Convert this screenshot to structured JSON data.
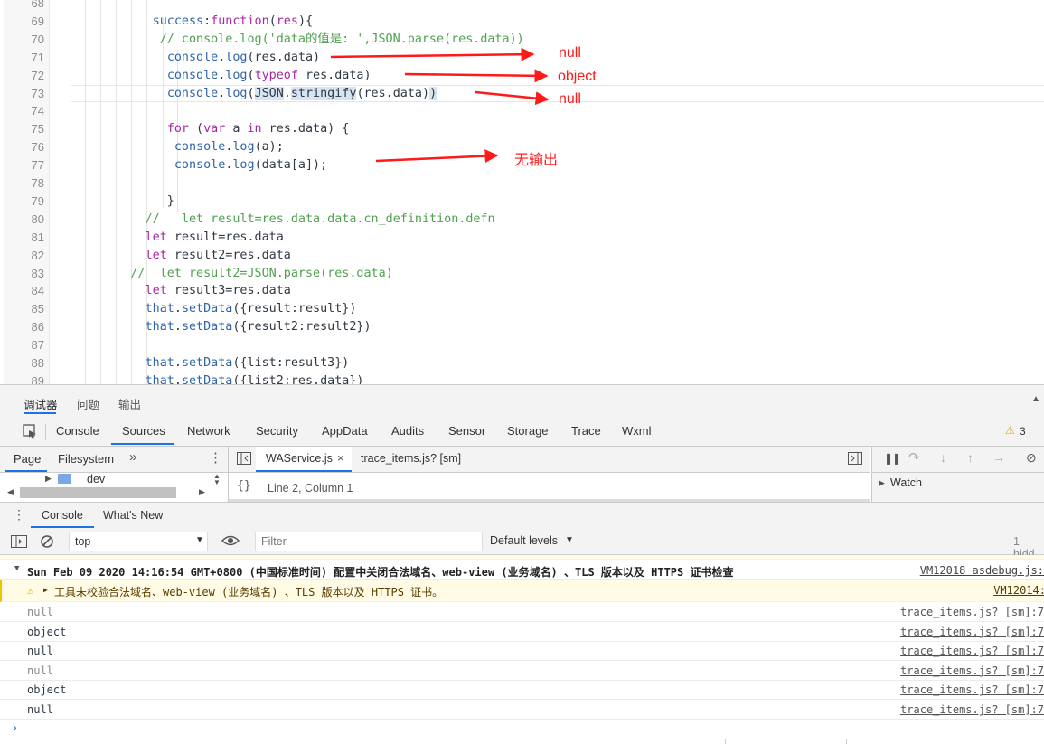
{
  "editor": {
    "lines": [
      {
        "num": "68",
        "html": ""
      },
      {
        "num": "69",
        "html": "           <span class='fn'>success</span>:<span class='kw'>function</span>(<span class='kw'>res</span>){"
      },
      {
        "num": "70",
        "html": "            <span class='cm'>// console.log('data的值是: ',JSON.parse(res.data))</span>"
      },
      {
        "num": "71",
        "html": "             <span class='fn'>console</span>.<span class='fn'>log</span>(res.data)"
      },
      {
        "num": "72",
        "html": "             <span class='fn'>console</span>.<span class='fn'>log</span>(<span class='ty'>typeof</span> res.data)"
      },
      {
        "num": "73",
        "html": "             <span class='fn'>console</span>.<span class='fn'>log</span>(<span class='hl'>JSON</span>.<span class='hl'>stringify</span>(res.data)<span class='hl'>)</span>"
      },
      {
        "num": "74",
        "html": ""
      },
      {
        "num": "75",
        "html": "             <span class='kw'>for</span> (<span class='kw'>var</span> a <span class='kw'>in</span> res.data) {"
      },
      {
        "num": "76",
        "html": "              <span class='fn'>console</span>.<span class='fn'>log</span>(a);"
      },
      {
        "num": "77",
        "html": "              <span class='fn'>console</span>.<span class='fn'>log</span>(data[a]);"
      },
      {
        "num": "78",
        "html": ""
      },
      {
        "num": "79",
        "html": "             }"
      },
      {
        "num": "80",
        "html": "          <span class='cm'>//   let result=res.data.data.cn_definition.defn</span>"
      },
      {
        "num": "81",
        "html": "          <span class='kw'>let</span> result=res.data"
      },
      {
        "num": "82",
        "html": "          <span class='kw'>let</span> result2=res.data"
      },
      {
        "num": "83",
        "html": "        <span class='cm'>//  let result2=JSON.parse(res.data)</span>"
      },
      {
        "num": "84",
        "html": "          <span class='kw'>let</span> result3=res.data"
      },
      {
        "num": "85",
        "html": "          <span class='fn'>that</span>.<span class='fn'>setData</span>({result:result})"
      },
      {
        "num": "86",
        "html": "          <span class='fn'>that</span>.<span class='fn'>setData</span>({result2:result2})"
      },
      {
        "num": "87",
        "html": ""
      },
      {
        "num": "88",
        "html": "          <span class='fn'>that</span>.<span class='fn'>setData</span>({list:result3})"
      },
      {
        "num": "89",
        "html": "          <span class='fn'>that</span>.<span class='fn'>setData</span>({list2:res.data})"
      }
    ],
    "annotations": {
      "a1": "null",
      "a2": "object",
      "a3": "null",
      "a4": "无输出"
    },
    "arrow_color": "#ff1a1a"
  },
  "devtools": {
    "top_tabs": [
      "调试器",
      "问题",
      "输出"
    ],
    "panel_tabs": [
      "Console",
      "Sources",
      "Network",
      "Security",
      "AppData",
      "Audits",
      "Sensor",
      "Storage",
      "Trace",
      "Wxml"
    ],
    "warning_count": "3",
    "nav_tabs": [
      "Page",
      "Filesystem"
    ],
    "tree_item": "dev",
    "editor_tabs": [
      "WAService.js",
      "trace_items.js? [sm]"
    ],
    "cursor_position": "Line 2, Column 1",
    "watch_label": "Watch",
    "drawer_tabs": [
      "Console",
      "What's New"
    ],
    "context": "top",
    "filter_placeholder": "Filter",
    "levels": "Default levels",
    "hidden": "1 hidd"
  },
  "console": {
    "group_header": "Sun Feb 09 2020 14:16:54 GMT+0800 (中国标准时间) 配置中关闭合法域名、web-view (业务域名) 、TLS 版本以及 HTTPS 证书检查",
    "group_src": "VM12018 asdebug.js:",
    "warning": "工具未校验合法域名、web-view (业务域名) 、TLS 版本以及 HTTPS 证书。",
    "warning_src": "VM12014:",
    "logs": [
      {
        "text": "null",
        "src": "trace_items.js? [sm]:7"
      },
      {
        "text": "object",
        "src": "trace_items.js? [sm]:7"
      },
      {
        "text": "null",
        "src": "trace_items.js? [sm]:7"
      },
      {
        "text": "null",
        "src": "trace_items.js? [sm]:7"
      },
      {
        "text": "object",
        "src": "trace_items.js? [sm]:7"
      },
      {
        "text": "null",
        "src": "trace_items.js? [sm]:7"
      }
    ],
    "prompt": "›"
  }
}
